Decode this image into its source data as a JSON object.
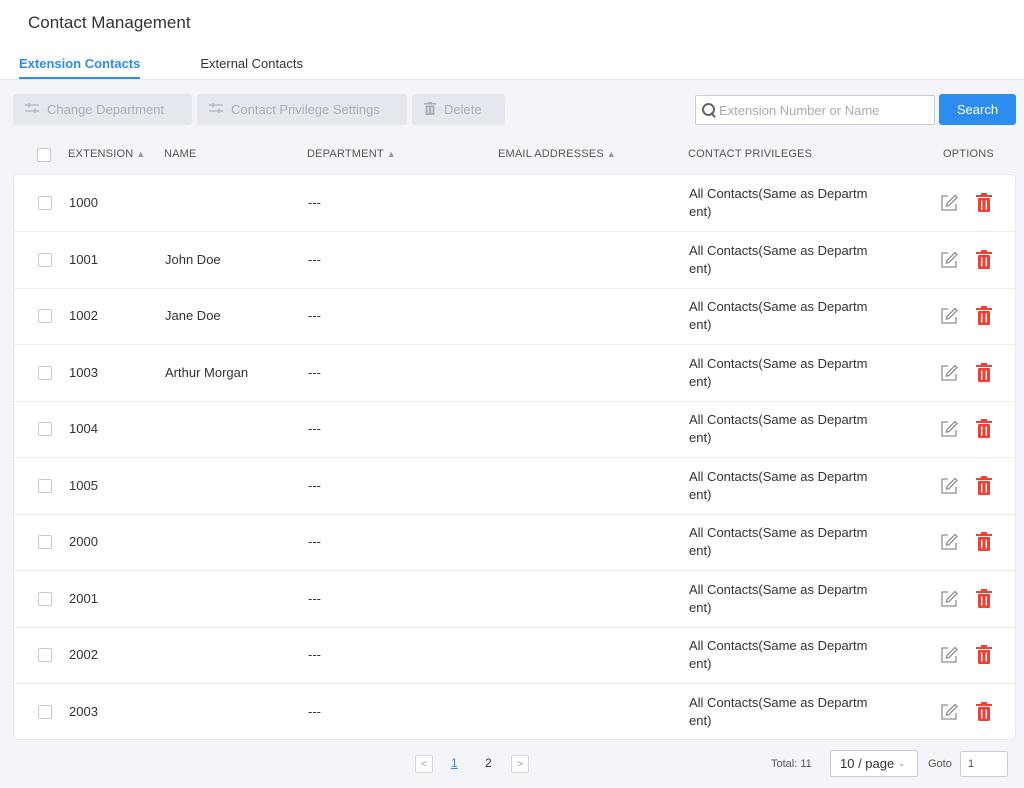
{
  "header": {
    "title": "Contact Management",
    "tabs": [
      {
        "label": "Extension Contacts",
        "active": true
      },
      {
        "label": "External Contacts",
        "active": false
      }
    ]
  },
  "toolbar": {
    "change_department": "Change Department",
    "privilege_settings": "Contact Privilege Settings",
    "delete": "Delete",
    "search_placeholder": "Extension Number or Name",
    "search_button": "Search"
  },
  "table": {
    "columns": {
      "extension": "EXTENSION",
      "name": "NAME",
      "department": "DEPARTMENT",
      "email": "EMAIL ADDRESSES",
      "privileges": "CONTACT PRIVILEGES",
      "options": "OPTIONS"
    },
    "rows": [
      {
        "extension": "1000",
        "name": "",
        "department": "---",
        "email": "",
        "privileges": "All Contacts(Same as Department)"
      },
      {
        "extension": "1001",
        "name": "John Doe",
        "department": "---",
        "email": "",
        "privileges": "All Contacts(Same as Department)"
      },
      {
        "extension": "1002",
        "name": "Jane Doe",
        "department": "---",
        "email": "",
        "privileges": "All Contacts(Same as Department)"
      },
      {
        "extension": "1003",
        "name": "Arthur Morgan",
        "department": "---",
        "email": "",
        "privileges": "All Contacts(Same as Department)"
      },
      {
        "extension": "1004",
        "name": "",
        "department": "---",
        "email": "",
        "privileges": "All Contacts(Same as Department)"
      },
      {
        "extension": "1005",
        "name": "",
        "department": "---",
        "email": "",
        "privileges": "All Contacts(Same as Department)"
      },
      {
        "extension": "2000",
        "name": "",
        "department": "---",
        "email": "",
        "privileges": "All Contacts(Same as Department)"
      },
      {
        "extension": "2001",
        "name": "",
        "department": "---",
        "email": "",
        "privileges": "All Contacts(Same as Department)"
      },
      {
        "extension": "2002",
        "name": "",
        "department": "---",
        "email": "",
        "privileges": "All Contacts(Same as Department)"
      },
      {
        "extension": "2003",
        "name": "",
        "department": "---",
        "email": "",
        "privileges": "All Contacts(Same as Department)"
      }
    ]
  },
  "pagination": {
    "pages": [
      "1",
      "2"
    ],
    "current": "1",
    "total": "Total: 11",
    "page_size": "10 / page",
    "goto_label": "Goto",
    "goto_value": "1"
  },
  "colors": {
    "accent": "#2d8cf0",
    "danger": "#f04134",
    "disabled_bg": "#e4e8ee"
  }
}
